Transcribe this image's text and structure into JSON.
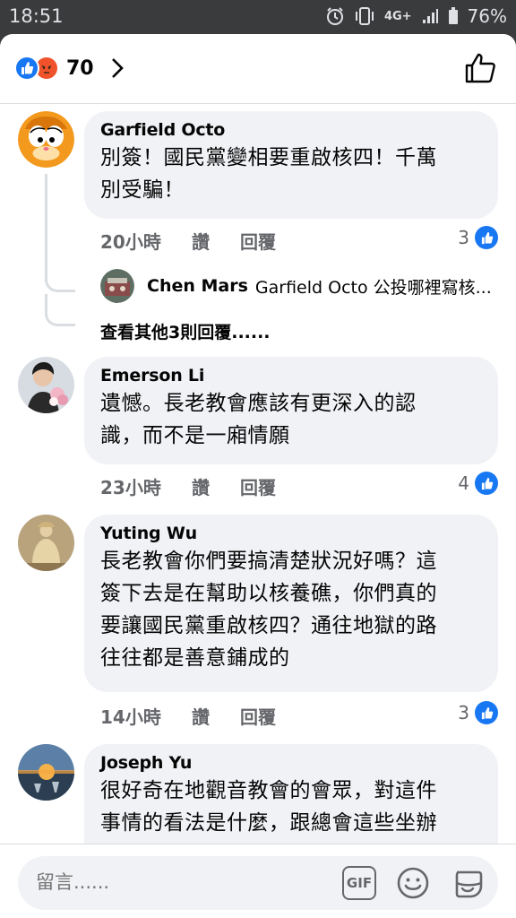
{
  "status": {
    "time": "18:51",
    "network": "4G+",
    "battery": "76%"
  },
  "header": {
    "reaction_count": "70",
    "reaction_icons": [
      "like-icon",
      "angry-icon"
    ]
  },
  "comments": [
    {
      "author": "Garfield Octo",
      "text": "別簽！國民黨變相要重啟核四！千萬別受騙！",
      "lines": [
        "別簽！國民黨變相要重啟核四！千萬",
        "別受騙！"
      ],
      "time": "20小時",
      "like": "讚",
      "reply": "回覆",
      "reactions": "3"
    },
    {
      "author": "Emerson Li",
      "lines": [
        "遺憾。長老教會應該有更深入的認",
        "識，而不是一廂情願"
      ],
      "time": "23小時",
      "like": "讚",
      "reply": "回覆",
      "reactions": "4"
    },
    {
      "author": "Yuting Wu",
      "lines": [
        "長老教會你們要搞清楚狀況好嗎？這",
        "簽下去是在幫助以核養礁，你們真的",
        "要讓國民黨重啟核四？通往地獄的路",
        "往往都是善意鋪成的"
      ],
      "time": "14小時",
      "like": "讚",
      "reply": "回覆",
      "reactions": "3"
    },
    {
      "author": "Joseph Yu",
      "lines": [
        "很好奇在地觀音教會的會眾，對這件",
        "事情的看法是什麼，跟總會這些坐辦"
      ]
    }
  ],
  "reply_preview": {
    "author": "Chen Mars",
    "text": "Garfield Octo 公投哪裡寫核..."
  },
  "more_replies": "查看其他3則回覆......",
  "composer": {
    "placeholder": "留言......",
    "gif_label": "GIF"
  },
  "colors": {
    "accent": "#1877f2",
    "bubble": "#f0f2f5",
    "meta": "#65676b",
    "angry": "#f0532b"
  }
}
